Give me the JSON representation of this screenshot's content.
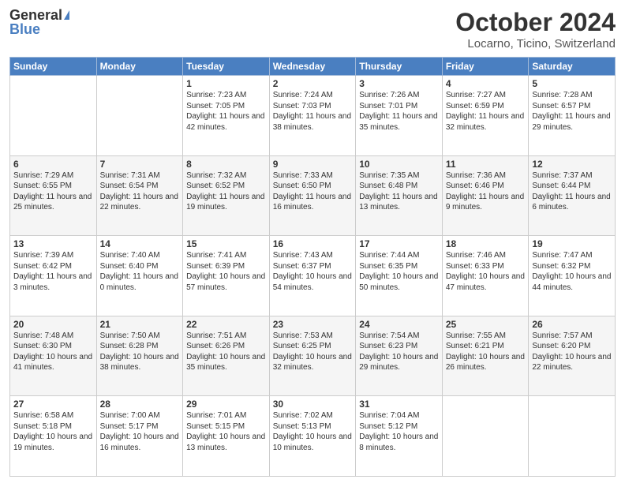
{
  "header": {
    "logo_general": "General",
    "logo_blue": "Blue",
    "title": "October 2024",
    "location": "Locarno, Ticino, Switzerland"
  },
  "weekdays": [
    "Sunday",
    "Monday",
    "Tuesday",
    "Wednesday",
    "Thursday",
    "Friday",
    "Saturday"
  ],
  "weeks": [
    [
      {
        "day": "",
        "info": ""
      },
      {
        "day": "",
        "info": ""
      },
      {
        "day": "1",
        "info": "Sunrise: 7:23 AM\nSunset: 7:05 PM\nDaylight: 11 hours and 42 minutes."
      },
      {
        "day": "2",
        "info": "Sunrise: 7:24 AM\nSunset: 7:03 PM\nDaylight: 11 hours and 38 minutes."
      },
      {
        "day": "3",
        "info": "Sunrise: 7:26 AM\nSunset: 7:01 PM\nDaylight: 11 hours and 35 minutes."
      },
      {
        "day": "4",
        "info": "Sunrise: 7:27 AM\nSunset: 6:59 PM\nDaylight: 11 hours and 32 minutes."
      },
      {
        "day": "5",
        "info": "Sunrise: 7:28 AM\nSunset: 6:57 PM\nDaylight: 11 hours and 29 minutes."
      }
    ],
    [
      {
        "day": "6",
        "info": "Sunrise: 7:29 AM\nSunset: 6:55 PM\nDaylight: 11 hours and 25 minutes."
      },
      {
        "day": "7",
        "info": "Sunrise: 7:31 AM\nSunset: 6:54 PM\nDaylight: 11 hours and 22 minutes."
      },
      {
        "day": "8",
        "info": "Sunrise: 7:32 AM\nSunset: 6:52 PM\nDaylight: 11 hours and 19 minutes."
      },
      {
        "day": "9",
        "info": "Sunrise: 7:33 AM\nSunset: 6:50 PM\nDaylight: 11 hours and 16 minutes."
      },
      {
        "day": "10",
        "info": "Sunrise: 7:35 AM\nSunset: 6:48 PM\nDaylight: 11 hours and 13 minutes."
      },
      {
        "day": "11",
        "info": "Sunrise: 7:36 AM\nSunset: 6:46 PM\nDaylight: 11 hours and 9 minutes."
      },
      {
        "day": "12",
        "info": "Sunrise: 7:37 AM\nSunset: 6:44 PM\nDaylight: 11 hours and 6 minutes."
      }
    ],
    [
      {
        "day": "13",
        "info": "Sunrise: 7:39 AM\nSunset: 6:42 PM\nDaylight: 11 hours and 3 minutes."
      },
      {
        "day": "14",
        "info": "Sunrise: 7:40 AM\nSunset: 6:40 PM\nDaylight: 11 hours and 0 minutes."
      },
      {
        "day": "15",
        "info": "Sunrise: 7:41 AM\nSunset: 6:39 PM\nDaylight: 10 hours and 57 minutes."
      },
      {
        "day": "16",
        "info": "Sunrise: 7:43 AM\nSunset: 6:37 PM\nDaylight: 10 hours and 54 minutes."
      },
      {
        "day": "17",
        "info": "Sunrise: 7:44 AM\nSunset: 6:35 PM\nDaylight: 10 hours and 50 minutes."
      },
      {
        "day": "18",
        "info": "Sunrise: 7:46 AM\nSunset: 6:33 PM\nDaylight: 10 hours and 47 minutes."
      },
      {
        "day": "19",
        "info": "Sunrise: 7:47 AM\nSunset: 6:32 PM\nDaylight: 10 hours and 44 minutes."
      }
    ],
    [
      {
        "day": "20",
        "info": "Sunrise: 7:48 AM\nSunset: 6:30 PM\nDaylight: 10 hours and 41 minutes."
      },
      {
        "day": "21",
        "info": "Sunrise: 7:50 AM\nSunset: 6:28 PM\nDaylight: 10 hours and 38 minutes."
      },
      {
        "day": "22",
        "info": "Sunrise: 7:51 AM\nSunset: 6:26 PM\nDaylight: 10 hours and 35 minutes."
      },
      {
        "day": "23",
        "info": "Sunrise: 7:53 AM\nSunset: 6:25 PM\nDaylight: 10 hours and 32 minutes."
      },
      {
        "day": "24",
        "info": "Sunrise: 7:54 AM\nSunset: 6:23 PM\nDaylight: 10 hours and 29 minutes."
      },
      {
        "day": "25",
        "info": "Sunrise: 7:55 AM\nSunset: 6:21 PM\nDaylight: 10 hours and 26 minutes."
      },
      {
        "day": "26",
        "info": "Sunrise: 7:57 AM\nSunset: 6:20 PM\nDaylight: 10 hours and 22 minutes."
      }
    ],
    [
      {
        "day": "27",
        "info": "Sunrise: 6:58 AM\nSunset: 5:18 PM\nDaylight: 10 hours and 19 minutes."
      },
      {
        "day": "28",
        "info": "Sunrise: 7:00 AM\nSunset: 5:17 PM\nDaylight: 10 hours and 16 minutes."
      },
      {
        "day": "29",
        "info": "Sunrise: 7:01 AM\nSunset: 5:15 PM\nDaylight: 10 hours and 13 minutes."
      },
      {
        "day": "30",
        "info": "Sunrise: 7:02 AM\nSunset: 5:13 PM\nDaylight: 10 hours and 10 minutes."
      },
      {
        "day": "31",
        "info": "Sunrise: 7:04 AM\nSunset: 5:12 PM\nDaylight: 10 hours and 8 minutes."
      },
      {
        "day": "",
        "info": ""
      },
      {
        "day": "",
        "info": ""
      }
    ]
  ]
}
